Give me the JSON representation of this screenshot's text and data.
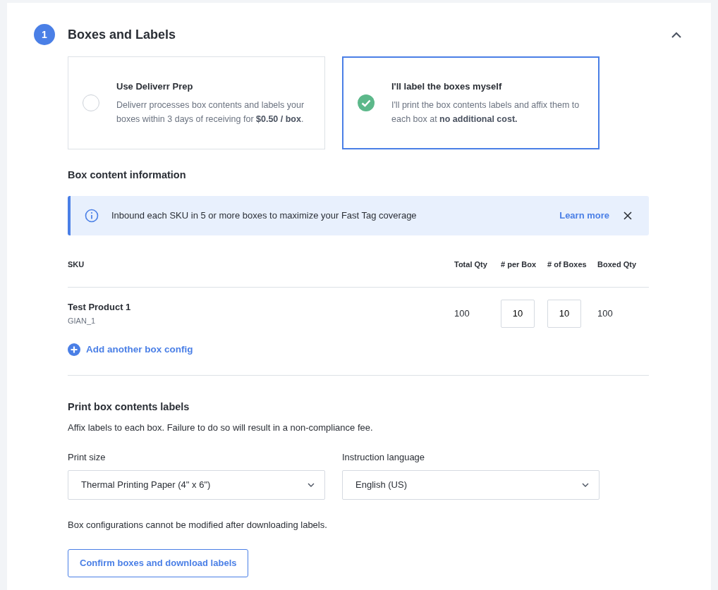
{
  "section": {
    "number": "1",
    "title": "Boxes and Labels",
    "expanded": true
  },
  "options": [
    {
      "title": "Use Deliverr Prep",
      "description": "Deliverr processes box contents and labels your boxes within 3 days of receiving for **$0.50 / box**.",
      "selected": false
    },
    {
      "title": "I'll label the boxes myself",
      "description": "I'll print the box contents labels and affix them to each box at **no additional cost.**",
      "selected": true
    }
  ],
  "box_content": {
    "heading": "Box content information",
    "banner": {
      "text": "Inbound each SKU in 5 or more boxes to maximize your Fast Tag coverage",
      "link": "Learn more"
    },
    "table": {
      "columns": [
        "SKU",
        "Total Qty",
        "# per Box",
        "# of Boxes",
        "Boxed Qty"
      ],
      "rows": [
        {
          "name": "Test Product 1",
          "code": "GIAN_1",
          "total_qty": "100",
          "per_box": "10",
          "num_boxes": "10",
          "boxed_qty": "100"
        }
      ]
    },
    "add_link": "Add another box config"
  },
  "print": {
    "heading": "Print box contents labels",
    "description": "Affix labels to each box. Failure to do so will result in a non-compliance fee.",
    "fields": [
      {
        "label": "Print size",
        "value": "Thermal Printing Paper (4\" x 6\")"
      },
      {
        "label": "Instruction language",
        "value": "English (US)"
      }
    ],
    "note": "Box configurations cannot be modified after downloading labels.",
    "button": "Confirm boxes and download labels"
  }
}
